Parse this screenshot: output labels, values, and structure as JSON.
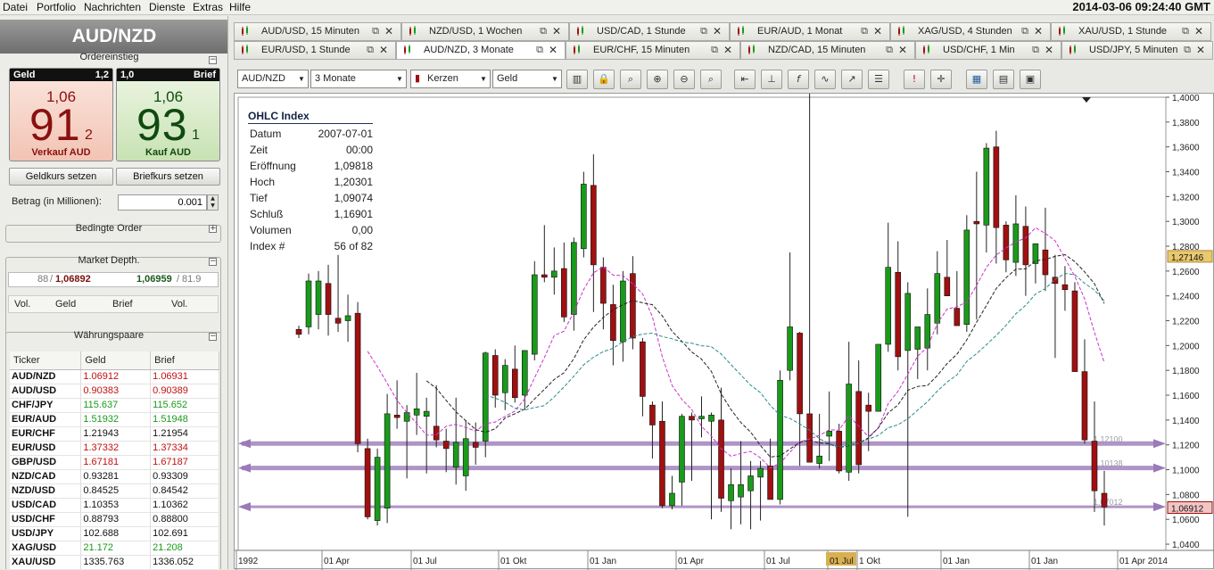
{
  "menu": [
    "Datei",
    "Portfolio",
    "Nachrichten",
    "Dienste",
    "Extras",
    "Hilfe"
  ],
  "datetime": "2014-03-06 09:24:40 GMT",
  "pair": "AUD/NZD",
  "order_entry": {
    "title": "Ordereinstieg",
    "sell": {
      "label": "Geld",
      "spread": "1,2",
      "big_prefix": "1,06",
      "big": "91",
      "pip": "2",
      "caption": "Verkauf AUD"
    },
    "buy": {
      "label": "Brief",
      "spread": "1,0",
      "big_prefix": "1,06",
      "big": "93",
      "pip": "1",
      "caption": "Kauf AUD"
    },
    "set_bid_label": "Geldkurs setzen",
    "set_ask_label": "Briefkurs setzen",
    "amount_label": "Betrag (in Millionen):",
    "amount_value": "0.001"
  },
  "conditional_order": "Bedingte Order",
  "market_depth": {
    "title": "Market Depth.",
    "bid_vol": "88",
    "bid": "1,06892",
    "ask": "1,06959",
    "ask_vol": "81.9",
    "cols": [
      "Vol.",
      "Geld",
      "Brief",
      "Vol."
    ]
  },
  "currency_pairs": {
    "title": "Währungspaare",
    "headers": [
      "Ticker",
      "Geld",
      "Brief"
    ],
    "rows": [
      {
        "t": "AUD/NZD",
        "g": "1.06912",
        "b": "1.06931",
        "c": "dn"
      },
      {
        "t": "AUD/USD",
        "g": "0.90383",
        "b": "0.90389",
        "c": "dn"
      },
      {
        "t": "CHF/JPY",
        "g": "115.637",
        "b": "115.652",
        "c": "up"
      },
      {
        "t": "EUR/AUD",
        "g": "1.51932",
        "b": "1.51948",
        "c": "up"
      },
      {
        "t": "EUR/CHF",
        "g": "1.21943",
        "b": "1.21954",
        "c": "nt"
      },
      {
        "t": "EUR/USD",
        "g": "1.37332",
        "b": "1.37334",
        "c": "dn"
      },
      {
        "t": "GBP/USD",
        "g": "1.67181",
        "b": "1.67187",
        "c": "dn"
      },
      {
        "t": "NZD/CAD",
        "g": "0.93281",
        "b": "0.93309",
        "c": "nt"
      },
      {
        "t": "NZD/USD",
        "g": "0.84525",
        "b": "0.84542",
        "c": "nt"
      },
      {
        "t": "USD/CAD",
        "g": "1.10353",
        "b": "1.10362",
        "c": "nt"
      },
      {
        "t": "USD/CHF",
        "g": "0.88793",
        "b": "0.88800",
        "c": "nt"
      },
      {
        "t": "USD/JPY",
        "g": "102.688",
        "b": "102.691",
        "c": "nt"
      },
      {
        "t": "XAG/USD",
        "g": "21.172",
        "b": "21.208",
        "c": "up"
      },
      {
        "t": "XAU/USD",
        "g": "1335.763",
        "b": "1336.052",
        "c": "nt"
      }
    ]
  },
  "tabs_row1": [
    {
      "label": "AUD/USD,  15 Minuten"
    },
    {
      "label": "NZD/USD,  1 Wochen"
    },
    {
      "label": "USD/CAD,  1 Stunde"
    },
    {
      "label": "EUR/AUD,  1 Monat"
    },
    {
      "label": "XAG/USD,  4 Stunden"
    },
    {
      "label": "XAU/USD,  1 Stunde"
    }
  ],
  "tabs_row2": [
    {
      "label": "EUR/USD,  1 Stunde"
    },
    {
      "label": "AUD/NZD,  3 Monate"
    },
    {
      "label": "EUR/CHF,  15 Minuten"
    },
    {
      "label": "NZD/CAD,  15 Minuten"
    },
    {
      "label": "USD/CHF,  1 Min"
    },
    {
      "label": "USD/JPY,  5 Minuten"
    }
  ],
  "toolbar": {
    "instrument": "AUD/NZD",
    "period": "3 Monate",
    "chart_type": "Kerzen",
    "price": "Geld"
  },
  "ohlc": {
    "title": "OHLC Index",
    "rows": [
      [
        "Datum",
        "2007-07-01"
      ],
      [
        "Zeit",
        "00:00"
      ],
      [
        "Eröffnung",
        "1,09818"
      ],
      [
        "Hoch",
        "1,20301"
      ],
      [
        "Tief",
        "1,09074"
      ],
      [
        "Schluß",
        "1,16901"
      ],
      [
        "Volumen",
        "0,00"
      ],
      [
        "Index #",
        "56 of 82"
      ]
    ]
  },
  "chart_data": {
    "type": "candlestick",
    "y_ticks": [
      "1,4000",
      "1,3800",
      "1,3600",
      "1,3400",
      "1,3200",
      "1,3000",
      "1,2800",
      "1,2600",
      "1,2400",
      "1,2200",
      "1,2000",
      "1,1800",
      "1,1600",
      "1,1400",
      "1,1200",
      "1,1000",
      "1,0800",
      "1,0600",
      "1,0400"
    ],
    "ylim": [
      1.035,
      1.4
    ],
    "x_ticks": [
      "1992",
      "01 Apr",
      "01 Jul",
      "01 Okt",
      "01 Jan",
      "01 Apr",
      "01 Jul",
      "01 Jul",
      "1 Okt",
      "01 Jan",
      "01 Jan",
      "01 Apr 2014"
    ],
    "price_labels": {
      "last": "1,06912",
      "cursor": "1,27146"
    },
    "hlines": [
      {
        "label": "1,12100",
        "value": 1.121
      },
      {
        "label": "1,10138",
        "value": 1.10138
      },
      {
        "label": "1,07012",
        "value": 1.07012
      }
    ],
    "colors": {
      "up": "#1a9a1a",
      "down": "#a01010",
      "hline": "#9a7ab8",
      "ma1": "#cc33cc",
      "ma2": "#222222",
      "ma3": "#2a8a8a"
    },
    "candles": [
      [
        1.213,
        1.216,
        1.206,
        1.209
      ],
      [
        1.215,
        1.258,
        1.209,
        1.252
      ],
      [
        1.225,
        1.26,
        1.213,
        1.252
      ],
      [
        1.25,
        1.265,
        1.208,
        1.225
      ],
      [
        1.222,
        1.273,
        1.211,
        1.218
      ],
      [
        1.22,
        1.241,
        1.203,
        1.224
      ],
      [
        1.226,
        1.235,
        1.114,
        1.121
      ],
      [
        1.117,
        1.125,
        1.06,
        1.062
      ],
      [
        1.059,
        1.117,
        1.055,
        1.11
      ],
      [
        1.069,
        1.161,
        1.057,
        1.145
      ],
      [
        1.144,
        1.172,
        1.133,
        1.142
      ],
      [
        1.139,
        1.152,
        1.093,
        1.146
      ],
      [
        1.144,
        1.178,
        1.128,
        1.149
      ],
      [
        1.143,
        1.158,
        1.097,
        1.147
      ],
      [
        1.135,
        1.168,
        1.118,
        1.124
      ],
      [
        1.123,
        1.133,
        1.098,
        1.117
      ],
      [
        1.102,
        1.158,
        1.088,
        1.122
      ],
      [
        1.095,
        1.14,
        1.083,
        1.125
      ],
      [
        1.122,
        1.138,
        1.104,
        1.118
      ],
      [
        1.123,
        1.195,
        1.11,
        1.194
      ],
      [
        1.192,
        1.197,
        1.15,
        1.16
      ],
      [
        1.162,
        1.189,
        1.148,
        1.184
      ],
      [
        1.181,
        1.2,
        1.154,
        1.158
      ],
      [
        1.16,
        1.196,
        1.149,
        1.196
      ],
      [
        1.193,
        1.268,
        1.188,
        1.257
      ],
      [
        1.257,
        1.297,
        1.251,
        1.255
      ],
      [
        1.255,
        1.279,
        1.241,
        1.26
      ],
      [
        1.262,
        1.283,
        1.219,
        1.223
      ],
      [
        1.225,
        1.287,
        1.212,
        1.283
      ],
      [
        1.278,
        1.34,
        1.271,
        1.33
      ],
      [
        1.329,
        1.354,
        1.227,
        1.265
      ],
      [
        1.263,
        1.271,
        1.213,
        1.234
      ],
      [
        1.233,
        1.249,
        1.184,
        1.204
      ],
      [
        1.203,
        1.26,
        1.187,
        1.252
      ],
      [
        1.258,
        1.272,
        1.197,
        1.206
      ],
      [
        1.203,
        1.206,
        1.143,
        1.159
      ],
      [
        1.152,
        1.155,
        1.109,
        1.136
      ],
      [
        1.139,
        1.155,
        1.069,
        1.071
      ],
      [
        1.071,
        1.095,
        1.068,
        1.081
      ],
      [
        1.09,
        1.145,
        1.071,
        1.143
      ],
      [
        1.143,
        1.146,
        1.091,
        1.14
      ],
      [
        1.141,
        1.159,
        1.126,
        1.143
      ],
      [
        1.139,
        1.146,
        1.06,
        1.144
      ],
      [
        1.14,
        1.166,
        1.066,
        1.077
      ],
      [
        1.075,
        1.101,
        1.052,
        1.088
      ],
      [
        1.078,
        1.123,
        1.056,
        1.088
      ],
      [
        1.083,
        1.107,
        1.052,
        1.095
      ],
      [
        1.094,
        1.107,
        1.059,
        1.101
      ],
      [
        1.103,
        1.125,
        1.09,
        1.076
      ],
      [
        1.076,
        1.18,
        1.072,
        1.172
      ],
      [
        1.18,
        1.275,
        1.172,
        1.215
      ],
      [
        1.21,
        1.211,
        1.103,
        1.145
      ],
      [
        1.145,
        1.407,
        1.11,
        1.106
      ],
      [
        1.105,
        1.145,
        1.101,
        1.111
      ],
      [
        1.127,
        1.163,
        1.107,
        1.131
      ],
      [
        1.131,
        1.137,
        1.097,
        1.099
      ],
      [
        1.098,
        1.203,
        1.091,
        1.169
      ],
      [
        1.163,
        1.188,
        1.097,
        1.104
      ],
      [
        1.152,
        1.162,
        1.115,
        1.147
      ],
      [
        1.147,
        1.195,
        1.147,
        1.201
      ],
      [
        1.201,
        1.299,
        1.195,
        1.263
      ],
      [
        1.259,
        1.284,
        1.18,
        1.191
      ],
      [
        1.196,
        1.251,
        1.062,
        1.242
      ],
      [
        1.197,
        1.201,
        1.173,
        1.215
      ],
      [
        1.198,
        1.246,
        1.18,
        1.225
      ],
      [
        1.218,
        1.276,
        1.209,
        1.258
      ],
      [
        1.255,
        1.285,
        1.241,
        1.24
      ],
      [
        1.23,
        1.26,
        1.218,
        1.216
      ],
      [
        1.217,
        1.305,
        1.211,
        1.293
      ],
      [
        1.3,
        1.34,
        1.221,
        1.298
      ],
      [
        1.297,
        1.363,
        1.275,
        1.359
      ],
      [
        1.36,
        1.373,
        1.266,
        1.295
      ],
      [
        1.297,
        1.3,
        1.259,
        1.269
      ],
      [
        1.267,
        1.321,
        1.256,
        1.298
      ],
      [
        1.296,
        1.312,
        1.24,
        1.265
      ],
      [
        1.266,
        1.272,
        1.25,
        1.282
      ],
      [
        1.277,
        1.311,
        1.244,
        1.257
      ],
      [
        1.255,
        1.273,
        1.19,
        1.25
      ],
      [
        1.249,
        1.264,
        1.228,
        1.245
      ],
      [
        1.244,
        1.251,
        1.195,
        1.179
      ],
      [
        1.179,
        1.205,
        1.121,
        1.124
      ],
      [
        1.123,
        1.155,
        1.066,
        1.083
      ],
      [
        1.081,
        1.099,
        1.055,
        1.07
      ]
    ]
  }
}
